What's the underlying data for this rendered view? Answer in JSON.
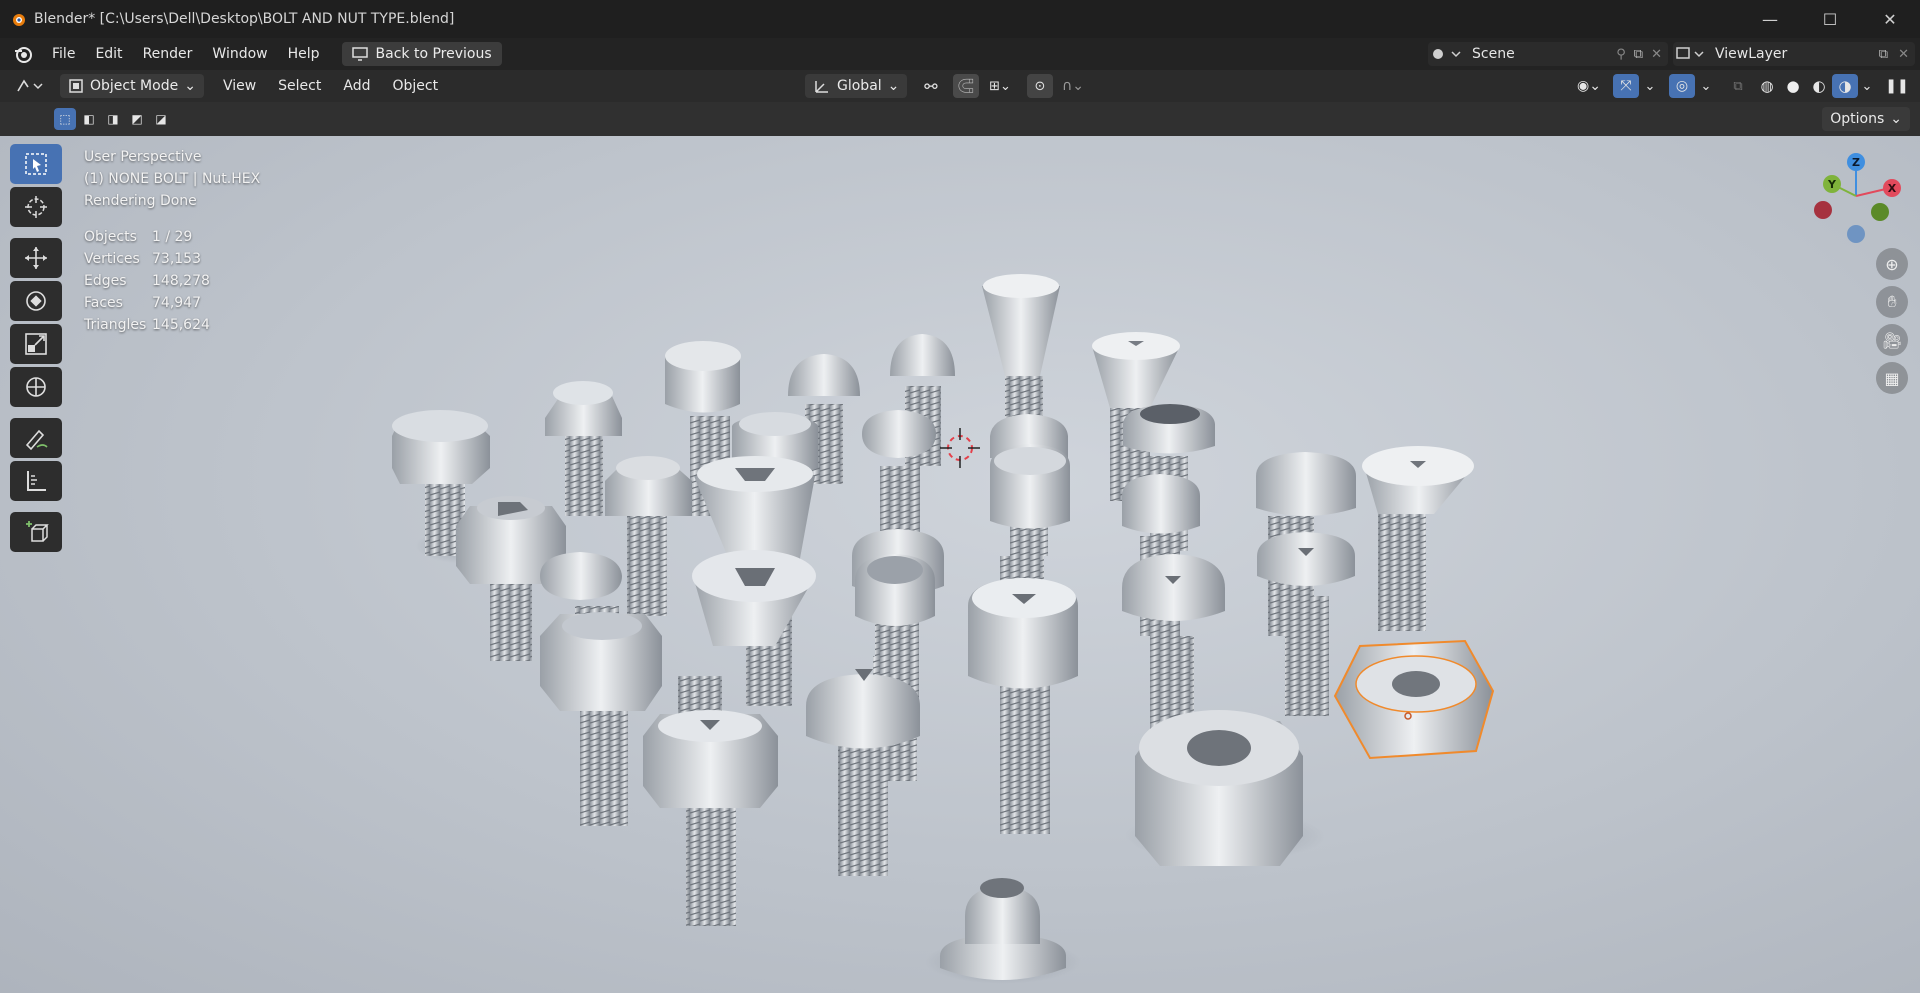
{
  "window": {
    "title": "Blender* [C:\\Users\\Dell\\Desktop\\BOLT AND NUT TYPE.blend]"
  },
  "menu": {
    "items": [
      "File",
      "Edit",
      "Render",
      "Window",
      "Help"
    ],
    "back_label": "Back to Previous"
  },
  "scene": {
    "name": "Scene"
  },
  "view_layer": {
    "name": "ViewLayer"
  },
  "header": {
    "mode": "Object Mode",
    "menus": [
      "View",
      "Select",
      "Add",
      "Object"
    ],
    "orientation": "Global",
    "options_label": "Options"
  },
  "viewport": {
    "perspective": "User Perspective",
    "active_object": "(1) NONE BOLT | Nut.HEX",
    "status": "Rendering Done",
    "stats": [
      {
        "label": "Objects",
        "value": "1 / 29"
      },
      {
        "label": "Vertices",
        "value": "73,153"
      },
      {
        "label": "Edges",
        "value": "148,278"
      },
      {
        "label": "Faces",
        "value": "74,947"
      },
      {
        "label": "Triangles",
        "value": "145,624"
      }
    ],
    "gizmo": {
      "x": "X",
      "y": "Y",
      "z": "Z"
    }
  },
  "colors": {
    "accent": "#4772b3",
    "selection": "#f08a2c",
    "axis_x": "#e24a5c",
    "axis_y": "#7fb33b",
    "axis_z": "#3f8fe0"
  }
}
